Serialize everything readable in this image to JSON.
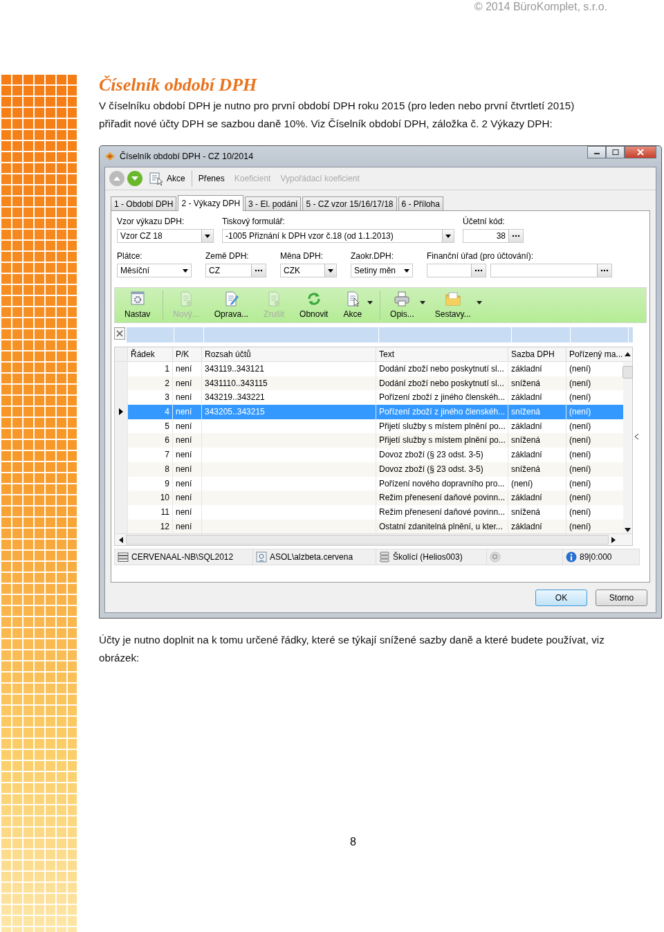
{
  "header": {
    "copyright": "© 2014 BüroKomplet, s.r.o."
  },
  "heading": "Číselník období DPH",
  "intro": "V číselníku období DPH je nutno pro první období DPH roku 2015 (pro leden nebo první čtvrtletí 2015) přiřadit nové účty DPH se sazbou daně 10%. Viz Číselník období DPH, záložka č. 2 Výkazy DPH:",
  "window": {
    "title": "Číselník období DPH - CZ 10/2014",
    "nav": [
      {
        "kind": "up",
        "disabled": true
      },
      {
        "kind": "down",
        "disabled": false
      }
    ],
    "toolbar": [
      {
        "label": "Akce",
        "disabled": false
      },
      {
        "label": "Přenes",
        "disabled": false
      },
      {
        "label": "Koeficient",
        "disabled": true
      },
      {
        "label": "Vypořádací koeficient",
        "disabled": true
      }
    ],
    "tabs": [
      {
        "label": "1 - Období DPH",
        "selected": false
      },
      {
        "label": "2 - Výkazy DPH",
        "selected": true
      },
      {
        "label": "3 - El. podání",
        "selected": false
      },
      {
        "label": "5 - CZ vzor 15/16/17/18",
        "selected": false
      },
      {
        "label": "6 - Příloha",
        "selected": false
      }
    ],
    "form_rows": [
      [
        {
          "label": "Vzor výkazu DPH:",
          "value": "Vzor CZ 18",
          "kind": "dropdown"
        },
        {
          "label": "Tiskový formulář:",
          "value": "-1005 Přiznání k DPH vzor č.18 (od 1.1.2013)",
          "kind": "dropdown"
        },
        {
          "label": "Účetní kód:",
          "value": "38",
          "kind": "lookup"
        }
      ],
      [
        {
          "label": "Plátce:",
          "value": "Měsíční",
          "kind": "combo"
        },
        {
          "label": "Země DPH:",
          "value": "CZ",
          "kind": "lookup"
        },
        {
          "label": "Měna DPH:",
          "value": "CZK",
          "kind": "dropdown"
        },
        {
          "label": "Zaokr.DPH:",
          "value": "Setiny měn",
          "kind": "combo"
        },
        {
          "label": "Finanční úřad (pro účtování):",
          "kind": "lookup"
        },
        {
          "kind": "lookup"
        }
      ]
    ],
    "grid_toolbar": [
      {
        "label": "Nastav",
        "disabled": false,
        "dropdown": false,
        "separator": true
      },
      {
        "label": "Nový...",
        "disabled": true,
        "dropdown": false,
        "separator": false
      },
      {
        "label": "Oprava...",
        "disabled": false,
        "dropdown": false,
        "separator": false
      },
      {
        "label": "Zrušit",
        "disabled": true,
        "dropdown": false,
        "separator": false
      },
      {
        "label": "Obnovit",
        "disabled": false,
        "dropdown": false,
        "separator": false
      },
      {
        "label": "Akce",
        "disabled": false,
        "dropdown": true,
        "separator": true
      },
      {
        "label": "Opis...",
        "disabled": false,
        "dropdown": true,
        "separator": false
      },
      {
        "label": "Sestavy...",
        "disabled": false,
        "dropdown": true,
        "separator": false
      }
    ],
    "table": {
      "columns": [
        "Řádek",
        "P/K",
        "Rozsah účtů",
        "Text",
        "Sazba DPH",
        "Pořízený ma..."
      ],
      "rows": [
        {
          "cells": [
            "1",
            "není",
            "343119..343121",
            "Dodání zboží nebo poskytnutí sl...",
            "základní",
            "(není)"
          ],
          "selected": false
        },
        {
          "cells": [
            "2",
            "není",
            "3431110..343115",
            "Dodání zboží nebo poskytnutí sl...",
            "snížená",
            "(není)"
          ],
          "selected": false
        },
        {
          "cells": [
            "3",
            "není",
            "343219..343221",
            "Pořízení zboží z jiného členskéh...",
            "základní",
            "(není)"
          ],
          "selected": false
        },
        {
          "cells": [
            "4",
            "není",
            "343205..343215",
            "Pořízení zboží z jiného členskéh...",
            "snížená",
            "(není)"
          ],
          "selected": true
        },
        {
          "cells": [
            "5",
            "není",
            "",
            "Přijetí služby s místem plnění po...",
            "základní",
            "(není)"
          ],
          "selected": false
        },
        {
          "cells": [
            "6",
            "není",
            "",
            "Přijetí služby s místem plnění po...",
            "snížená",
            "(není)"
          ],
          "selected": false
        },
        {
          "cells": [
            "7",
            "není",
            "",
            "Dovoz zboží (§ 23 odst. 3-5)",
            "základní",
            "(není)"
          ],
          "selected": false
        },
        {
          "cells": [
            "8",
            "není",
            "",
            "Dovoz zboží (§ 23 odst. 3-5)",
            "snížená",
            "(není)"
          ],
          "selected": false
        },
        {
          "cells": [
            "9",
            "není",
            "",
            "Pořízení nového dopravního pro...",
            "(není)",
            "(není)"
          ],
          "selected": false
        },
        {
          "cells": [
            "10",
            "není",
            "",
            "Režim přenesení daňové povinn...",
            "základní",
            "(není)"
          ],
          "selected": false
        },
        {
          "cells": [
            "11",
            "není",
            "",
            "Režim přenesení daňové povinn...",
            "snížená",
            "(není)"
          ],
          "selected": false
        },
        {
          "cells": [
            "12",
            "není",
            "",
            "Ostatní zdanitelná plnění, u kter...",
            "základní",
            "(není)"
          ],
          "selected": false
        }
      ]
    },
    "status_bar": [
      "CERVENAAL-NB\\SQL2012",
      "ASOL\\alzbeta.cervena",
      "Školící (Helios003)",
      "89|0:000"
    ],
    "buttons": [
      {
        "label": "OK",
        "default": true
      },
      {
        "label": "Storno",
        "default": false
      }
    ]
  },
  "outro": "Účty je nutno doplnit na k tomu určené řádky, které se týkají snížené sazby daně a které budete používat, viz obrázek:",
  "page_number": "8"
}
